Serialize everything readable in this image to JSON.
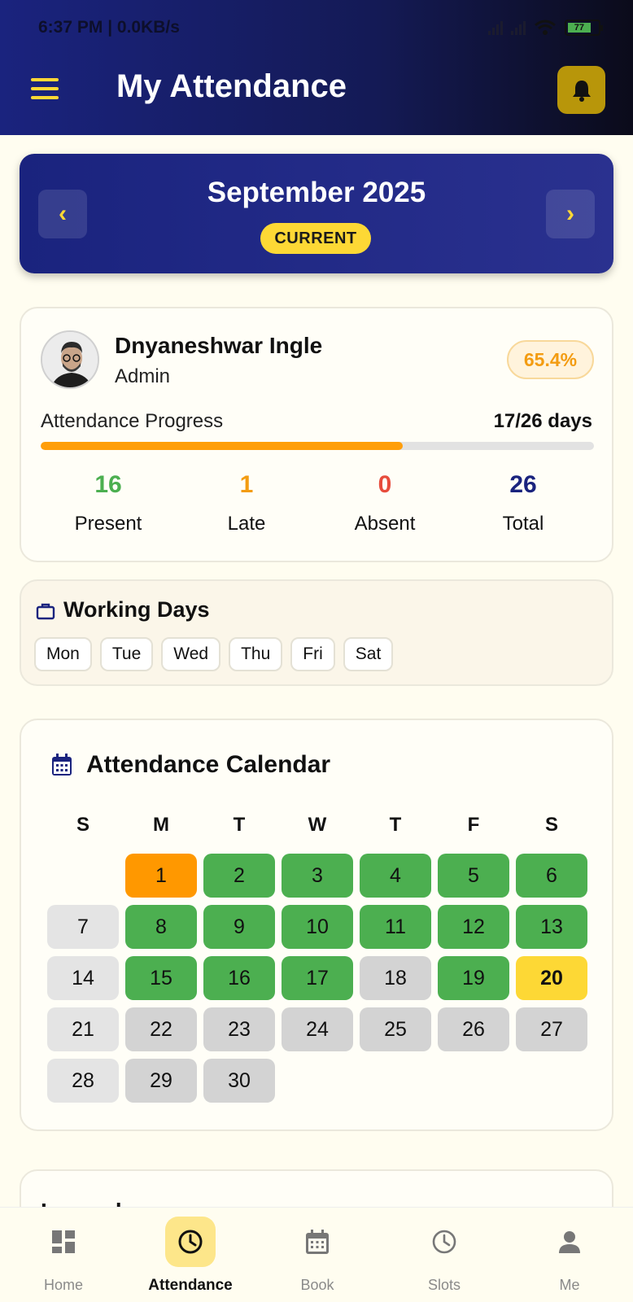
{
  "status_bar": {
    "time": "6:37 PM | 0.0KB/s",
    "battery": "77"
  },
  "header": {
    "title": "My Attendance"
  },
  "month_card": {
    "title": "September 2025",
    "badge": "CURRENT",
    "prev": "‹",
    "next": "›"
  },
  "profile": {
    "name": "Dnyaneshwar Ingle",
    "role": "Admin",
    "percentage": "65.4%",
    "progress_label": "Attendance Progress",
    "progress_days": "17/26 days",
    "progress_fraction": 0.654,
    "stats": [
      {
        "value": "16",
        "label": "Present",
        "color": "#4caf50"
      },
      {
        "value": "1",
        "label": "Late",
        "color": "#f39c12"
      },
      {
        "value": "0",
        "label": "Absent",
        "color": "#e74c3c"
      },
      {
        "value": "26",
        "label": "Total",
        "color": "#1a237e"
      }
    ]
  },
  "working_days": {
    "title": "Working Days",
    "days": [
      "Mon",
      "Tue",
      "Wed",
      "Thu",
      "Fri",
      "Sat"
    ]
  },
  "calendar": {
    "title": "Attendance Calendar",
    "weekdays": [
      "S",
      "M",
      "T",
      "W",
      "T",
      "F",
      "S"
    ],
    "start_offset": 1,
    "days": [
      {
        "d": "1",
        "s": "late"
      },
      {
        "d": "2",
        "s": "present"
      },
      {
        "d": "3",
        "s": "present"
      },
      {
        "d": "4",
        "s": "present"
      },
      {
        "d": "5",
        "s": "present"
      },
      {
        "d": "6",
        "s": "present"
      },
      {
        "d": "7",
        "s": "off"
      },
      {
        "d": "8",
        "s": "present"
      },
      {
        "d": "9",
        "s": "present"
      },
      {
        "d": "10",
        "s": "present"
      },
      {
        "d": "11",
        "s": "present"
      },
      {
        "d": "12",
        "s": "present"
      },
      {
        "d": "13",
        "s": "present"
      },
      {
        "d": "14",
        "s": "off"
      },
      {
        "d": "15",
        "s": "present"
      },
      {
        "d": "16",
        "s": "present"
      },
      {
        "d": "17",
        "s": "present"
      },
      {
        "d": "18",
        "s": "none"
      },
      {
        "d": "19",
        "s": "present"
      },
      {
        "d": "20",
        "s": "today"
      },
      {
        "d": "21",
        "s": "off"
      },
      {
        "d": "22",
        "s": "future"
      },
      {
        "d": "23",
        "s": "future"
      },
      {
        "d": "24",
        "s": "future"
      },
      {
        "d": "25",
        "s": "future"
      },
      {
        "d": "26",
        "s": "future"
      },
      {
        "d": "27",
        "s": "future"
      },
      {
        "d": "28",
        "s": "off"
      },
      {
        "d": "29",
        "s": "future"
      },
      {
        "d": "30",
        "s": "future"
      }
    ],
    "status_colors": {
      "present": "#4caf50",
      "late": "#ff9800",
      "off": "#e4e4e4",
      "none": "#d3d3d3",
      "future": "#d3d3d3",
      "today": "#fdd835"
    }
  },
  "legend": {
    "title": "Legend"
  },
  "bottom_nav": {
    "items": [
      {
        "label": "Home",
        "icon": "grid-icon"
      },
      {
        "label": "Attendance",
        "icon": "clock-icon",
        "active": true
      },
      {
        "label": "Book",
        "icon": "calendar-icon"
      },
      {
        "label": "Slots",
        "icon": "clock-outline-icon"
      },
      {
        "label": "Me",
        "icon": "person-icon"
      }
    ]
  }
}
